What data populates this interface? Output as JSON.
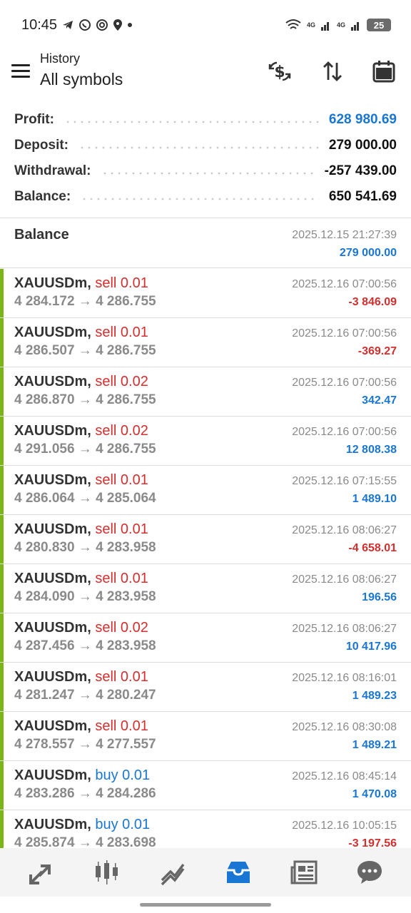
{
  "status_bar": {
    "time": "10:45",
    "network_labels": [
      "4G",
      "4G"
    ],
    "battery": "25"
  },
  "header": {
    "subtitle": "History",
    "title": "All symbols"
  },
  "summary": [
    {
      "label": "Profit:",
      "value": "628 980.69",
      "accent": true
    },
    {
      "label": "Deposit:",
      "value": "279 000.00",
      "accent": false
    },
    {
      "label": "Withdrawal:",
      "value": "-257 439.00",
      "accent": false
    },
    {
      "label": "Balance:",
      "value": "650 541.69",
      "accent": false
    }
  ],
  "balance_entry": {
    "label": "Balance",
    "time": "2025.12.15 21:27:39",
    "amount": "279 000.00"
  },
  "deals": [
    {
      "symbol": "XAUUSDm,",
      "side": "sell 0.01",
      "type": "sell",
      "prices": "4 284.172 → 4 286.755",
      "time": "2025.12.16 07:00:56",
      "profit": "-3 846.09",
      "negative": true
    },
    {
      "symbol": "XAUUSDm,",
      "side": "sell 0.01",
      "type": "sell",
      "prices": "4 286.507 → 4 286.755",
      "time": "2025.12.16 07:00:56",
      "profit": "-369.27",
      "negative": true
    },
    {
      "symbol": "XAUUSDm,",
      "side": "sell 0.02",
      "type": "sell",
      "prices": "4 286.870 → 4 286.755",
      "time": "2025.12.16 07:00:56",
      "profit": "342.47",
      "negative": false
    },
    {
      "symbol": "XAUUSDm,",
      "side": "sell 0.02",
      "type": "sell",
      "prices": "4 291.056 → 4 286.755",
      "time": "2025.12.16 07:00:56",
      "profit": "12 808.38",
      "negative": false
    },
    {
      "symbol": "XAUUSDm,",
      "side": "sell 0.01",
      "type": "sell",
      "prices": "4 286.064 → 4 285.064",
      "time": "2025.12.16 07:15:55",
      "profit": "1 489.10",
      "negative": false
    },
    {
      "symbol": "XAUUSDm,",
      "side": "sell 0.01",
      "type": "sell",
      "prices": "4 280.830 → 4 283.958",
      "time": "2025.12.16 08:06:27",
      "profit": "-4 658.01",
      "negative": true
    },
    {
      "symbol": "XAUUSDm,",
      "side": "sell 0.01",
      "type": "sell",
      "prices": "4 284.090 → 4 283.958",
      "time": "2025.12.16 08:06:27",
      "profit": "196.56",
      "negative": false
    },
    {
      "symbol": "XAUUSDm,",
      "side": "sell 0.02",
      "type": "sell",
      "prices": "4 287.456 → 4 283.958",
      "time": "2025.12.16 08:06:27",
      "profit": "10 417.96",
      "negative": false
    },
    {
      "symbol": "XAUUSDm,",
      "side": "sell 0.01",
      "type": "sell",
      "prices": "4 281.247 → 4 280.247",
      "time": "2025.12.16 08:16:01",
      "profit": "1 489.23",
      "negative": false
    },
    {
      "symbol": "XAUUSDm,",
      "side": "sell 0.01",
      "type": "sell",
      "prices": "4 278.557 → 4 277.557",
      "time": "2025.12.16 08:30:08",
      "profit": "1 489.21",
      "negative": false
    },
    {
      "symbol": "XAUUSDm,",
      "side": "buy 0.01",
      "type": "buy",
      "prices": "4 283.286 → 4 284.286",
      "time": "2025.12.16 08:45:14",
      "profit": "1 470.08",
      "negative": false
    },
    {
      "symbol": "XAUUSDm,",
      "side": "buy 0.01",
      "type": "buy",
      "prices": "4 285.874 → 4 283.698",
      "time": "2025.12.16 10:05:15",
      "profit": "-3 197.56",
      "negative": true
    }
  ],
  "bottom_nav": [
    {
      "icon": "quotes-icon",
      "active": false
    },
    {
      "icon": "chart-icon",
      "active": false
    },
    {
      "icon": "trade-icon",
      "active": false
    },
    {
      "icon": "history-icon",
      "active": true
    },
    {
      "icon": "news-icon",
      "active": false
    },
    {
      "icon": "chat-icon",
      "active": false
    }
  ],
  "colors": {
    "accent_blue": "#1976d2",
    "loss_red": "#d32f2f",
    "deal_bar_green": "#7cb518"
  }
}
